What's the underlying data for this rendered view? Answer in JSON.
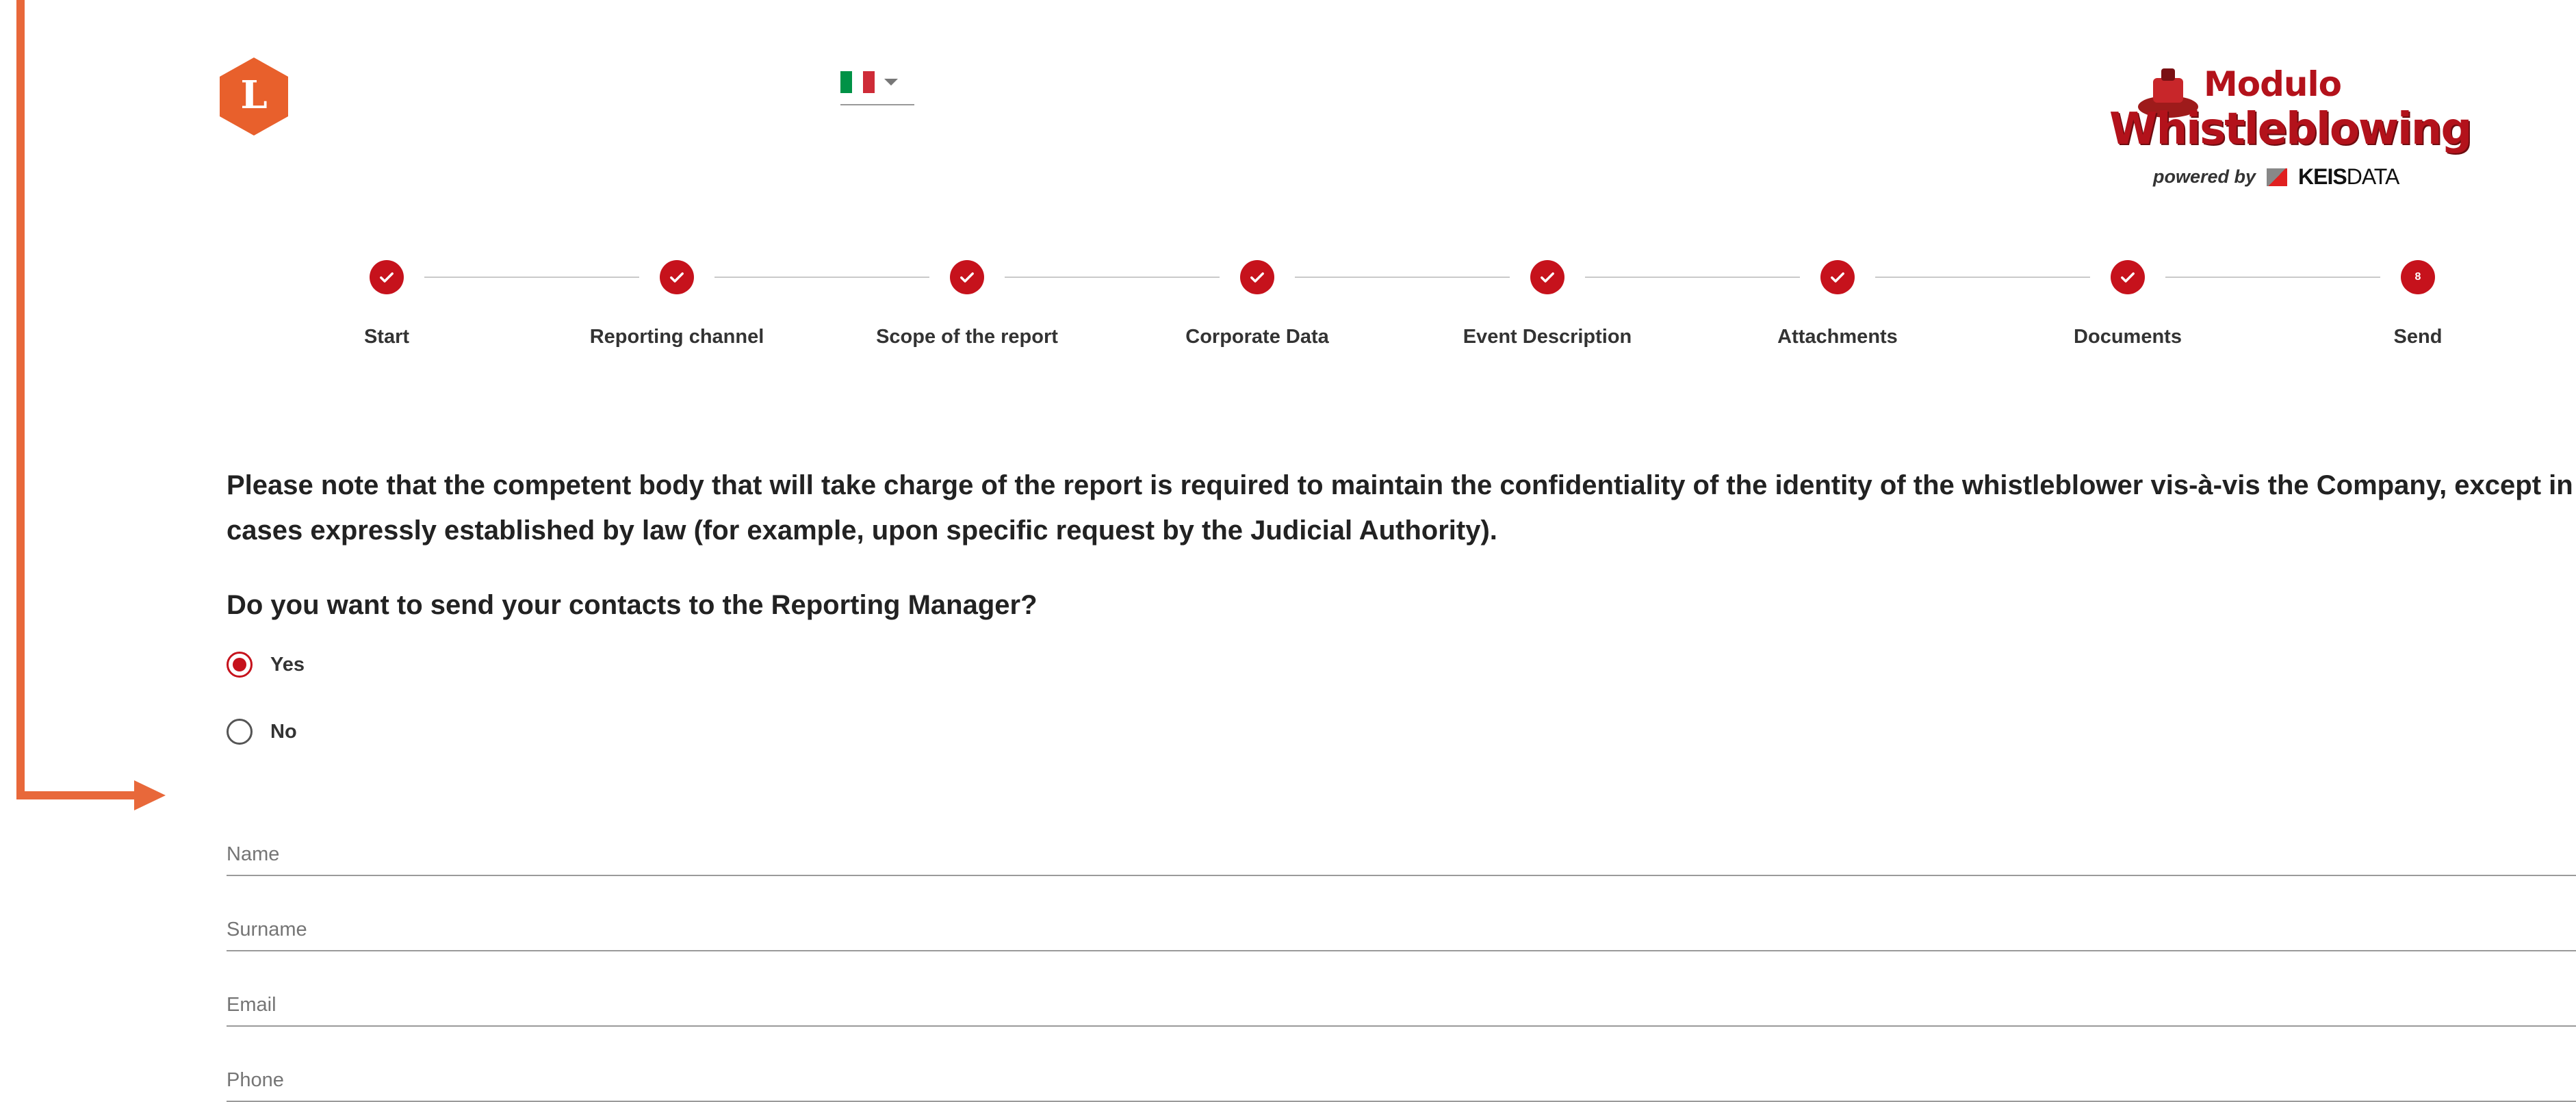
{
  "header": {
    "logo_letter": "L",
    "language": {
      "selected": "it-flag-icon"
    },
    "brand": {
      "line1": "Modulo",
      "line2": "Whistleblowing",
      "powered_by": "powered by",
      "vendor_bold": "KEIS",
      "vendor_light": "DATA"
    }
  },
  "colors": {
    "accent": "#c6121c",
    "annotation": "#e8683a",
    "logo": "#e8602c"
  },
  "stepper": {
    "steps": [
      {
        "label": "Start",
        "state": "done"
      },
      {
        "label": "Reporting channel",
        "state": "done"
      },
      {
        "label": "Scope of the report",
        "state": "done"
      },
      {
        "label": "Corporate Data",
        "state": "done"
      },
      {
        "label": "Event Description",
        "state": "done"
      },
      {
        "label": "Attachments",
        "state": "done"
      },
      {
        "label": "Documents",
        "state": "done"
      },
      {
        "label": "Send",
        "state": "current",
        "number": "8"
      }
    ]
  },
  "main": {
    "notice": "Please note that the competent body that will take charge of the report is required to maintain the confidentiality of the identity of the whistleblower vis-à-vis the Company, except in cases expressly established by law (for example, upon specific request by the Judicial Authority).",
    "question": "Do you want to send your contacts to the Reporting Manager?",
    "options": [
      {
        "label": "Yes",
        "selected": true
      },
      {
        "label": "No",
        "selected": false
      }
    ],
    "fields": {
      "name": {
        "placeholder": "Name",
        "value": ""
      },
      "surname": {
        "placeholder": "Surname",
        "value": ""
      },
      "email": {
        "placeholder": "Email",
        "value": ""
      },
      "phone": {
        "placeholder": "Phone",
        "value": ""
      }
    }
  }
}
